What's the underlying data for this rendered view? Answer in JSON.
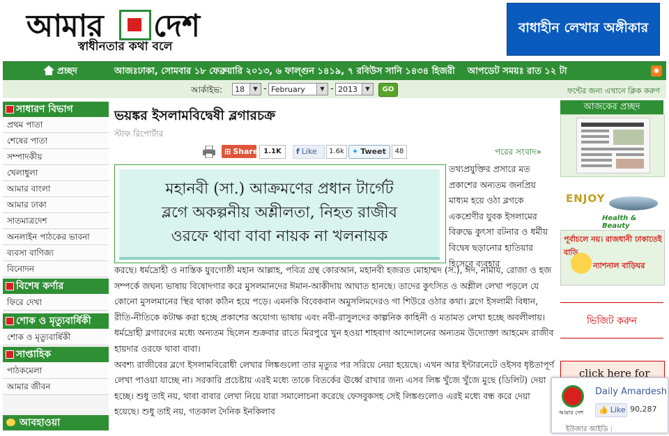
{
  "header": {
    "logo_part1": "আমার",
    "logo_part2": "দেশ",
    "tagline": "স্বাধীনতার কথা বলে",
    "banner_text": "বাধাহীন লেখার অঙ্গীকার"
  },
  "navbar": {
    "home_label": "প্রচ্ছদ",
    "dateline": "আজঃঢাকা, সোমবার ১৮ ফেব্রুয়ারি ২০১৩, ৬ ফাল্গুন ১৪১৯, ৭ রবিউস সানি ১৪৩৪ হিজরী    আপডেট সময়ঃ রাত ১২ টা"
  },
  "archive": {
    "label": "আর্কাইভ:",
    "day": "18",
    "month": "February",
    "year": "2013",
    "go_label": "GO",
    "font_help": "ফন্টের জন্য এখানে ক্লিক করুণ"
  },
  "sidebar": {
    "sections": [
      {
        "title": "সাধারণ বিভাগ",
        "items": [
          "প্রথম পাতা",
          "শেষের পাতা",
          "সম্পাদকীয়",
          "খেলাধুলা",
          "আমার বাংলা",
          "আমার ঢাকা",
          "সাতমাত্রদেশ",
          "অনলাইন পাঠকের ভাবনা",
          "ব্যবসা বাণিজ্য",
          "বিনোদন"
        ]
      },
      {
        "title": "বিশেষ কর্ণার",
        "items": [
          "ফিরে দেখা"
        ]
      },
      {
        "title": "শোক ও মৃত্যুবার্ষিকী",
        "items": [
          "শোক ও মৃত্যুবার্ষিকী"
        ]
      },
      {
        "title": "সাপ্তাহিক",
        "items": [
          "পাঠকমেলা",
          "আমার জীবন"
        ]
      }
    ],
    "weather_title": "আবহাওয়া"
  },
  "article": {
    "title": "ভয়ঙ্কর ইসলামবিদ্বেষী ব্লগারচক্র",
    "byline": "স্টাফ রিপোর্টার",
    "share_label": "Share",
    "share_count": "1.1K",
    "like_label": "Like",
    "like_count": "1.6k",
    "tweet_label": "Tweet",
    "tweet_count": "48",
    "next_news": "পরের সংবাদ»",
    "headline_image_lines": [
      "মহানবী (সা.) আক্রমণের প্রধান টার্গেট",
      "ব্লগে অকল্পনীয় অশ্লীলতা, নিহত রাজীব",
      "ওরফে থাবা বাবা নায়ক না খলনায়ক"
    ],
    "side_text": "তথ্যপ্রযুক্তির প্রসারে মত প্রকাশের অন্যতম জনপ্রিয় মাধ্যম হয়ে ওঠা ব্লগকে একশ্রেণীর যুবক ইসলামের বিরুদ্ধে কুৎসা রটনার ও ধর্মীয় বিদ্বেষ ছড়ানোর হাতিয়ার হিসেবে ব্যবহার",
    "body_para1": "করছে। ধর্মদ্রোহী ও নাস্তিক যুবগোষ্ঠী মহান আল্লাহ, পবিত্র গ্রন্থ কোরআন, মহানবী হজরত মোহাম্মদ (স.), ঈদ, নামায, রোজা ও হজ সম্পর্কে জঘন্য ভাষায় বিষোদগার করে মুসলমানদের ঈমান-আকীদায় আঘাত হানছে। তাদের কুৎসিত ও অশ্লীল লেখা পড়লে যে কোনো মুসলমানের স্থির থাকা কঠিন হয়ে পড়ে। এমনকি বিবেকবান অমুসলিমদেরও গা শিউরে ওঠার কথা। ব্লগে ইসলামী বিধান, রীতি-নীতিকে কটাক্ষ করা হচ্ছে প্রকাশের অযোগ্য ভাষায় এবং নবী-রাসুলদের কাল্পনিক কাহিনী ও মতামত লেখা হচ্ছে অবলীলায়। ধর্মদ্রোহী ব্লগারদের মধ্যে অন্যতম ছিলেন শুক্রবার রাতে মিরপুরে খুন হওয়া শাহবাগ আন্দোলনের অন্যতম উদ্যোক্তা আহমেদ রাজীব হায়দার ওরফে থাবা বাবা।",
    "body_para2": "অবশ্য রাজীবের ব্লগে ইসলামবিরোধী লেখার লিঙ্কগুলো তার মৃত্যুর পর সরিয়ে নেয়া হয়েছে। এখন আর ইন্টারনেটে ওইসব ধৃষ্টতাপূর্ণ লেখা পাওয়া যাচ্ছে না। সরকারি প্রচেষ্টায় এরই মধ্যে তাকে বিতর্কের ঊর্ধ্বে রাখার জন্য এসব লিঙ্ক খুঁজে খুঁজে মুছে (ডিলিট) দেয়া হচ্ছে। শুধু তাই নয়, থাবা বাবার লেখা নিয়ে যারা সমালোচনা করেছে ফেসবুকসহ সেই লিঙ্কগুলোও এরই মধ্যে বন্ধ করে দেয়া হয়েছে। শুধু তাই নয়, গতকাল দৈনিক ইনকিলাব"
  },
  "right": {
    "today_title": "আজকের প্রচ্ছদ",
    "ad1_text": "ENJOY",
    "ad1_sub": "Health & Beauty",
    "ad2_text": "পূর্বাচলে নয়। রাজধানী ঢাকাতেই বাড়ি",
    "ad2_sub": "ন্যাশনাল বাড়িঘর",
    "visit_text": "ভিজিট করুন",
    "click_text": "click here for"
  },
  "fb_widget": {
    "logo_text": "আমার দেশ",
    "name": "Daily Amardesh",
    "like_label": "Like",
    "count": "90,287",
    "user_label": "ইউজার আইডি :"
  },
  "colors": {
    "primary_green": "#2f8f34",
    "brand_red": "#d8201e",
    "banner_blue": "#0a5bbd"
  }
}
